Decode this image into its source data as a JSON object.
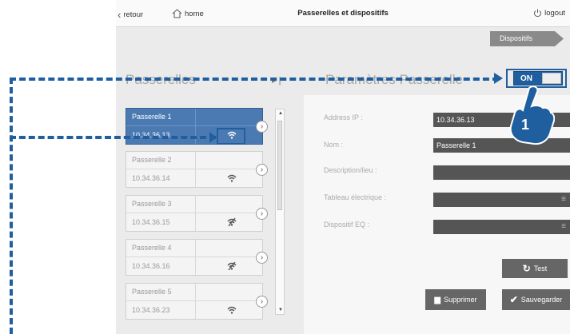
{
  "topbar": {
    "back_label": "retour",
    "home_label": "home",
    "title": "Passerelles et dispositifs",
    "logout_label": "logout"
  },
  "dispositifs_button": "Dispositifs",
  "gateways_section": {
    "title": "Passerelles",
    "items": [
      {
        "name": "Passerelle 1",
        "ip": "10.34.36.13",
        "signal": "wifi-icon",
        "active": true
      },
      {
        "name": "Passerelle 2",
        "ip": "10.34.36.14",
        "signal": "wifi-icon",
        "active": false
      },
      {
        "name": "Passerelle 3",
        "ip": "10.34.36.15",
        "signal": "wifi-off-icon",
        "active": false
      },
      {
        "name": "Passerelle 4",
        "ip": "10.34.36.16",
        "signal": "wifi-off-icon",
        "active": false
      },
      {
        "name": "Passerelle 5",
        "ip": "10.34.36.23",
        "signal": "wifi-icon",
        "active": false
      }
    ]
  },
  "params_section": {
    "title": "Paramètres Passerelle",
    "toggle_label": "ON",
    "toggle_on": true,
    "fields": {
      "ip_label": "Address IP :",
      "ip_value": "10.34.36.13",
      "name_label": "Nom :",
      "name_value": "Passerelle 1",
      "desc_label": "Description/lieu :",
      "desc_value": "",
      "panel_label": "Tableau électrique :",
      "panel_value": "",
      "device_label": "Dispositif EQ :",
      "device_value": ""
    }
  },
  "buttons": {
    "test": "Test",
    "delete": "Supprimer",
    "save": "Sauvegarder"
  },
  "annotation": {
    "step_number": "1",
    "color": "#1f5f9f"
  }
}
